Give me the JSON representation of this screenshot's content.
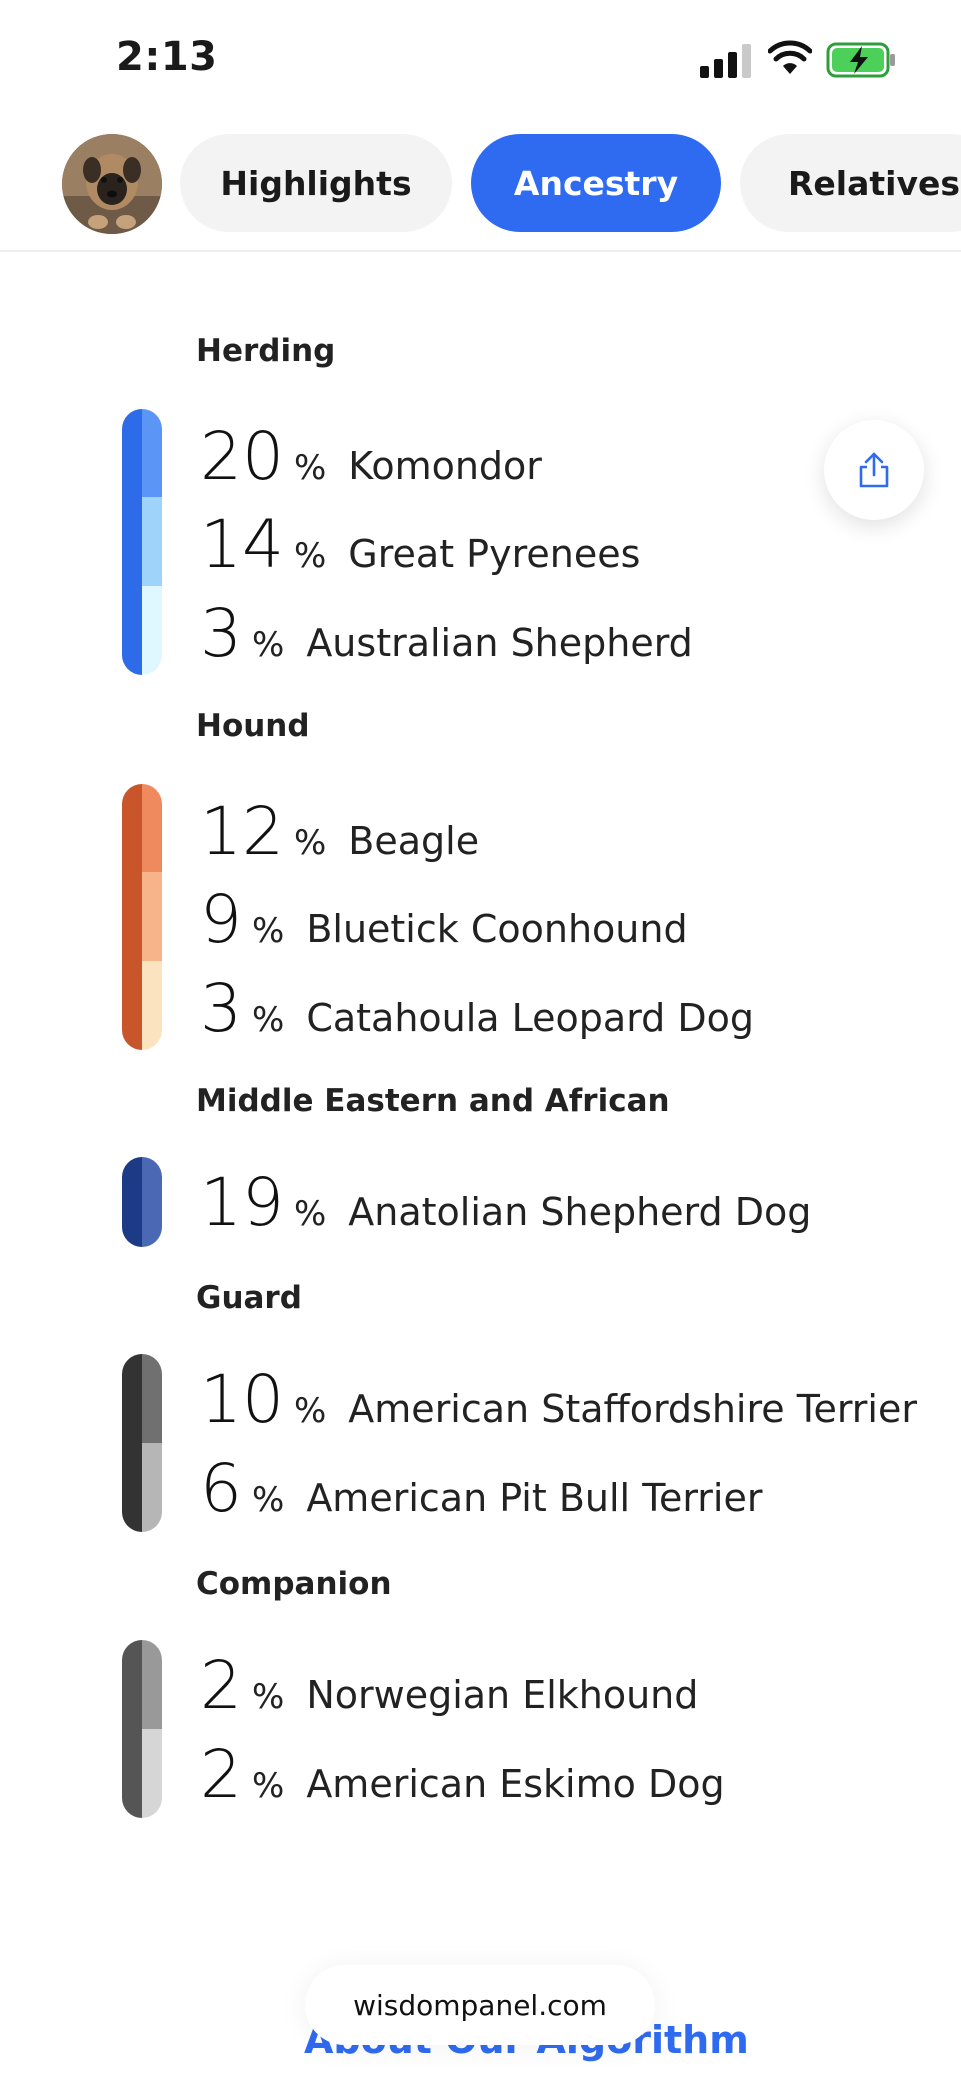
{
  "status_bar": {
    "time": "2:13",
    "icons": [
      "signal-icon",
      "wifi-icon",
      "battery-charging-icon"
    ]
  },
  "tabs": [
    {
      "label": "Highlights",
      "active": false
    },
    {
      "label": "Ancestry",
      "active": true
    },
    {
      "label": "Relatives",
      "active": false
    }
  ],
  "avatar_icon": "dog-avatar",
  "share_icon": "share-icon",
  "groups": [
    {
      "title": "Herding",
      "colors": {
        "dark": "#2e6be8",
        "light": [
          "#5b95f5",
          "#9fd3f9",
          "#dff8ff"
        ]
      },
      "breeds": [
        {
          "percent": "20",
          "unit": "%",
          "name": "Komondor"
        },
        {
          "percent": "14",
          "unit": "%",
          "name": "Great Pyrenees"
        },
        {
          "percent": "3",
          "unit": "%",
          "name": "Australian Shepherd"
        }
      ]
    },
    {
      "title": "Hound",
      "colors": {
        "dark": "#c9552a",
        "light": [
          "#ee8a5e",
          "#f7b48a",
          "#fbe3bf"
        ]
      },
      "breeds": [
        {
          "percent": "12",
          "unit": "%",
          "name": "Beagle"
        },
        {
          "percent": "9",
          "unit": "%",
          "name": "Bluetick Coonhound"
        },
        {
          "percent": "3",
          "unit": "%",
          "name": "Catahoula Leopard Dog"
        }
      ]
    },
    {
      "title": "Middle Eastern and African",
      "colors": {
        "dark": "#1d3a87",
        "light": [
          "#4a68b4"
        ]
      },
      "breeds": [
        {
          "percent": "19",
          "unit": "%",
          "name": "Anatolian Shepherd Dog"
        }
      ]
    },
    {
      "title": "Guard",
      "colors": {
        "dark": "#333333",
        "light": [
          "#707070",
          "#b6b6b6"
        ]
      },
      "breeds": [
        {
          "percent": "10",
          "unit": "%",
          "name": "American Staffordshire Terrier"
        },
        {
          "percent": "6",
          "unit": "%",
          "name": "American Pit Bull Terrier"
        }
      ]
    },
    {
      "title": "Companion",
      "colors": {
        "dark": "#555555",
        "light": [
          "#999999",
          "#d6d6d6"
        ]
      },
      "breeds": [
        {
          "percent": "2",
          "unit": "%",
          "name": "Norwegian Elkhound"
        },
        {
          "percent": "2",
          "unit": "%",
          "name": "American Eskimo Dog"
        }
      ]
    }
  ],
  "footer": {
    "link": "About Our Algorithm",
    "url": "wisdompanel.com"
  }
}
